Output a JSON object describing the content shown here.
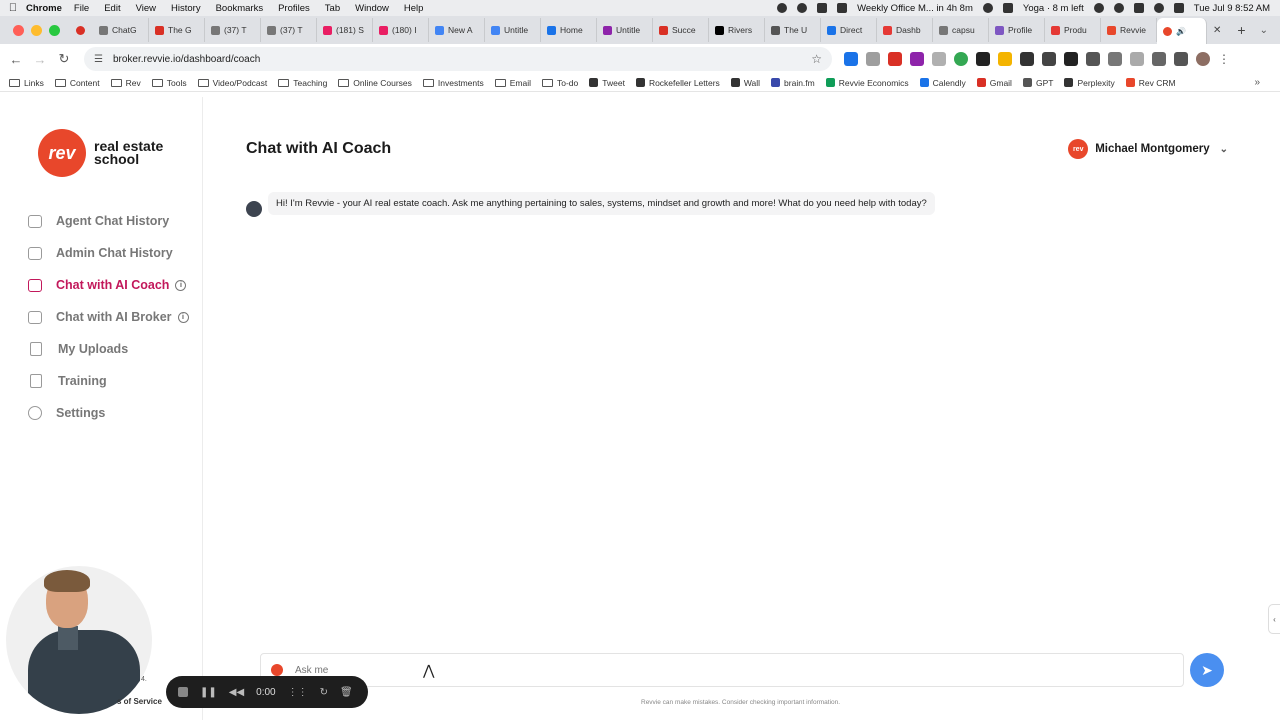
{
  "menubar": {
    "app_name": "Chrome",
    "items": [
      "File",
      "Edit",
      "View",
      "History",
      "Bookmarks",
      "Profiles",
      "Tab",
      "Window",
      "Help"
    ],
    "status": {
      "meeting": "Weekly Office M... in 4h 8m",
      "yoga": "Yoga · 8 m left",
      "datetime": "Tue Jul 9  8:52 AM"
    }
  },
  "tabs": [
    {
      "label": "ChatG",
      "color": "#777777"
    },
    {
      "label": "The G",
      "color": "#d93025"
    },
    {
      "label": "(37) T",
      "color": "#777777"
    },
    {
      "label": "(37) T",
      "color": "#777777"
    },
    {
      "label": "(181) S",
      "color": "#e91e63"
    },
    {
      "label": "(180) I",
      "color": "#e91e63"
    },
    {
      "label": "New A",
      "color": "#4285f4"
    },
    {
      "label": "Untitle",
      "color": "#4285f4"
    },
    {
      "label": "Home",
      "color": "#1a73e8"
    },
    {
      "label": "Untitle",
      "color": "#8e24aa"
    },
    {
      "label": "Succe",
      "color": "#d93025"
    },
    {
      "label": "Rivers",
      "color": "#000000"
    },
    {
      "label": "The U",
      "color": "#555555"
    },
    {
      "label": "Direct",
      "color": "#1a73e8"
    },
    {
      "label": "Dashb",
      "color": "#e53935"
    },
    {
      "label": "capsu",
      "color": "#777777"
    },
    {
      "label": "Profile",
      "color": "#7e57c2"
    },
    {
      "label": "Produ",
      "color": "#e53935"
    },
    {
      "label": "Revvie",
      "color": "#e8472b"
    }
  ],
  "toolbar": {
    "url": "broker.revvie.io/dashboard/coach"
  },
  "bookmarks": [
    {
      "label": "Links",
      "type": "folder"
    },
    {
      "label": "Content",
      "type": "folder"
    },
    {
      "label": "Rev",
      "type": "folder"
    },
    {
      "label": "Tools",
      "type": "folder"
    },
    {
      "label": "Video/Podcast",
      "type": "folder"
    },
    {
      "label": "Teaching",
      "type": "folder"
    },
    {
      "label": "Online Courses",
      "type": "folder"
    },
    {
      "label": "Investments",
      "type": "folder"
    },
    {
      "label": "Email",
      "type": "folder"
    },
    {
      "label": "To-do",
      "type": "folder"
    },
    {
      "label": "Tweet",
      "type": "link",
      "color": "#333333"
    },
    {
      "label": "Rockefeller Letters",
      "type": "link",
      "color": "#333333"
    },
    {
      "label": "Wall",
      "type": "link",
      "color": "#333333"
    },
    {
      "label": "brain.fm",
      "type": "link",
      "color": "#3949ab"
    },
    {
      "label": "Revvie Economics",
      "type": "link",
      "color": "#0f9d58"
    },
    {
      "label": "Calendly",
      "type": "link",
      "color": "#1a73e8"
    },
    {
      "label": "Gmail",
      "type": "link",
      "color": "#d93025"
    },
    {
      "label": "GPT",
      "type": "link",
      "color": "#555555"
    },
    {
      "label": "Perplexity",
      "type": "link",
      "color": "#333333"
    },
    {
      "label": "Rev CRM",
      "type": "link",
      "color": "#e8472b"
    }
  ],
  "sidebar": {
    "logo_mark": "rev",
    "logo_line1": "real estate",
    "logo_line2": "school",
    "items": [
      {
        "label": "Agent Chat History",
        "icon": "chat-icon",
        "active": false,
        "info": false
      },
      {
        "label": "Admin Chat History",
        "icon": "chat-icon",
        "active": false,
        "info": false
      },
      {
        "label": "Chat with AI Coach",
        "icon": "chat-icon",
        "active": true,
        "info": true
      },
      {
        "label": "Chat with AI Broker",
        "icon": "chat-icon",
        "active": false,
        "info": true
      },
      {
        "label": "My Uploads",
        "icon": "document-icon",
        "active": false,
        "info": false
      },
      {
        "label": "Training",
        "icon": "document-icon",
        "active": false,
        "info": false
      },
      {
        "label": "Settings",
        "icon": "gear-icon",
        "active": false,
        "info": false
      }
    ]
  },
  "main": {
    "title": "Chat with AI Coach",
    "user_name": "Michael Montgomery",
    "messages": [
      {
        "role": "assistant",
        "text": "Hi! I'm Revvie - your AI real estate coach. Ask me anything pertaining to sales, systems, mindset and growth and more! What do you need help with today?"
      }
    ],
    "composer_placeholder": "Ask me",
    "disclaimer": "Revvie can make mistakes. Consider checking important information."
  },
  "overlay": {
    "recorder_time": "0:00",
    "partial_text": "s of Service",
    "partial_text2": "4."
  },
  "colors": {
    "brand": "#e8472b",
    "active_nav": "#c2185b",
    "send_button": "#4a8ff0"
  }
}
